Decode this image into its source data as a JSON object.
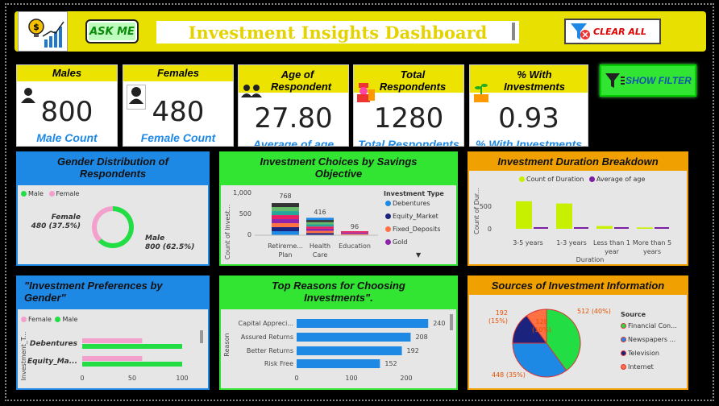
{
  "header": {
    "title": "Investment Insights Dashboard",
    "ask_me": "ASK ME",
    "clear_all": "CLEAR ALL",
    "show_filter": "SHOW FILTER"
  },
  "colors": {
    "yellow": "#e8e000",
    "green": "#33e533",
    "blue": "#1e88e5",
    "orange": "#f0a000"
  },
  "kpis": [
    {
      "title": "Males",
      "value": "800",
      "sub": "Male Count",
      "icon": "male-user-icon"
    },
    {
      "title": "Females",
      "value": "480",
      "sub": "Female Count",
      "icon": "female-user-icon"
    },
    {
      "title": "Age of Respondent",
      "value": "27.80",
      "sub": "Average of age",
      "icon": "group-icon"
    },
    {
      "title": "Total Respondents",
      "value": "1280",
      "sub": "Total Respondents",
      "icon": "people-icon"
    },
    {
      "title": "% With Investments",
      "value": "0.93",
      "sub": "% With Investments",
      "icon": "money-plant-icon"
    }
  ],
  "gender_panel": {
    "title": "Gender Distribution of Respondents",
    "legend": [
      "Male",
      "Female"
    ],
    "female_label": "Female",
    "female_value": "480 (37.5%)",
    "male_label": "Male",
    "male_value": "800 (62.5%)"
  },
  "savings_panel": {
    "title": "Investment Choices by Savings Objective",
    "ylabel": "Count of Invest...",
    "legend_title": "Investment Type",
    "legend": [
      "Debentures",
      "Equity_Market",
      "Fixed_Deposits",
      "Gold"
    ],
    "yticks": [
      "1,000",
      "500",
      "0"
    ],
    "cats": [
      "Retireme... Plan",
      "Health Care",
      "Education"
    ],
    "labels": [
      "768",
      "416",
      "96"
    ]
  },
  "duration_panel": {
    "title": "Investment Duration Breakdown",
    "legend": [
      "Count of Duration",
      "Average of age"
    ],
    "ylabel": "Count of Dur...",
    "xlabel": "Duration",
    "yticks": [
      "500",
      "0"
    ],
    "cats": [
      "3-5 years",
      "1-3 years",
      "Less than 1 year",
      "More than 5 years"
    ]
  },
  "pref_panel": {
    "title": "\"Investment Preferences by Gender\"",
    "legend": [
      "Female",
      "Male"
    ],
    "ylabel": "Investment_T...",
    "cats": [
      "Debentures",
      "Equity_Ma..."
    ],
    "xticks": [
      "0",
      "50",
      "100"
    ]
  },
  "reasons_panel": {
    "title": "Top Reasons for Choosing Investments\".",
    "ylabel": "Reason",
    "xticks": [
      "0",
      "100",
      "200"
    ]
  },
  "sources_panel": {
    "title": "Sources of Investment Information",
    "legend_title": "Source",
    "legend": [
      "Financial Con...",
      "Newspapers ...",
      "Television",
      "Internet"
    ],
    "labels": [
      "512 (40%)",
      "448 (35%)",
      "192 (15%)",
      "128 (10%)"
    ]
  },
  "chart_data": [
    {
      "type": "pie",
      "title": "Gender Distribution of Respondents",
      "categories": [
        "Male",
        "Female"
      ],
      "values": [
        800,
        480
      ]
    },
    {
      "type": "bar",
      "title": "Investment Choices by Savings Objective",
      "categories": [
        "Retirement Plan",
        "Health Care",
        "Education"
      ],
      "values": [
        768,
        416,
        96
      ],
      "ylim": [
        0,
        1000
      ]
    },
    {
      "type": "bar",
      "title": "Investment Duration Breakdown",
      "categories": [
        "3-5 years",
        "1-3 years",
        "Less than 1 year",
        "More than 5 years"
      ],
      "series": [
        {
          "name": "Count of Duration",
          "values": [
            610,
            560,
            60,
            30
          ]
        },
        {
          "name": "Average of age",
          "values": [
            28,
            27,
            27,
            26
          ]
        }
      ]
    },
    {
      "type": "bar",
      "title": "\"Investment Preferences by Gender\"",
      "categories": [
        "Debentures",
        "Equity_Market"
      ],
      "series": [
        {
          "name": "Female",
          "values": [
            60,
            60
          ]
        },
        {
          "name": "Male",
          "values": [
            100,
            100
          ]
        }
      ],
      "xlim": [
        0,
        100
      ]
    },
    {
      "type": "bar",
      "title": "Top Reasons for Choosing Investments\".",
      "categories": [
        "Capital Appreci...",
        "Assured Returns",
        "Better Returns",
        "Risk Free"
      ],
      "values": [
        240,
        208,
        192,
        152
      ]
    },
    {
      "type": "pie",
      "title": "Sources of Investment Information",
      "categories": [
        "Financial Consultants",
        "Newspapers and Magazines",
        "Television",
        "Internet"
      ],
      "values": [
        512,
        448,
        192,
        128
      ]
    }
  ]
}
